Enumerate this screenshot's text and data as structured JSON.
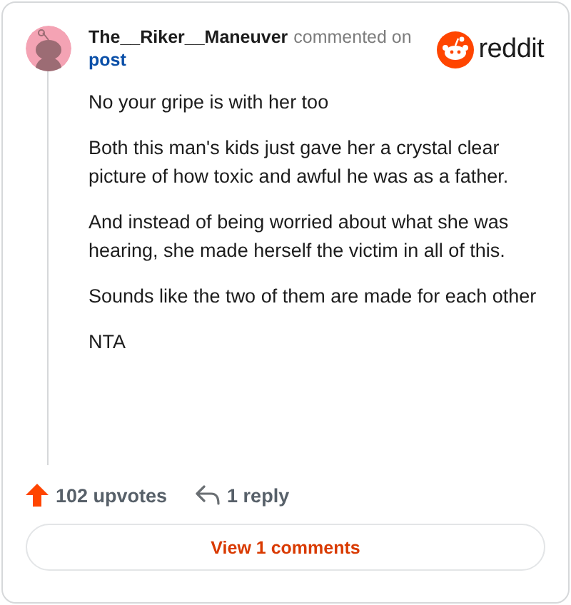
{
  "comment": {
    "author": "The__Riker__Maneuver",
    "action": "commented on",
    "target": "post"
  },
  "logo": {
    "text": "reddit"
  },
  "paragraphs": [
    "No your gripe is with her too",
    "Both this man's kids just gave her a crystal clear picture of how toxic and awful he was as a father.",
    "And instead of being worried about what she was hearing, she made herself the victim in all of this.",
    "Sounds like the two of them are made for each other",
    "NTA"
  ],
  "stats": {
    "upvotes": "102 upvotes",
    "replies": "1 reply"
  },
  "button": "View 1 comments"
}
